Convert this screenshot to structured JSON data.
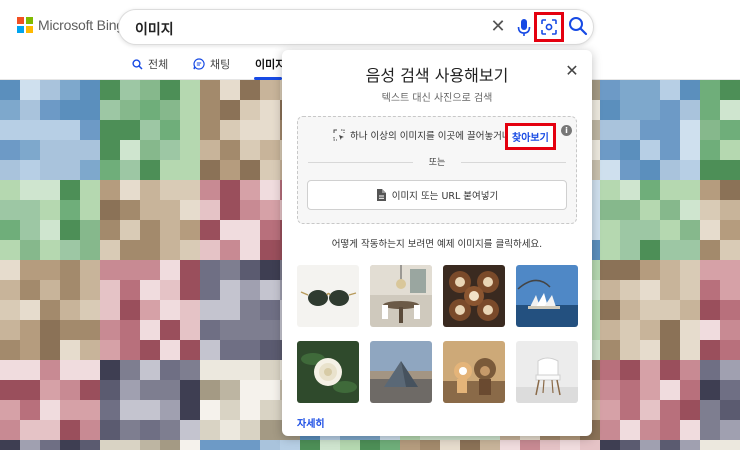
{
  "brand": {
    "name": "Microsoft Bing",
    "colors": [
      "#f25022",
      "#7fba00",
      "#00a4ef",
      "#ffb900"
    ]
  },
  "search": {
    "query": "이미지",
    "clear_icon": "close-icon",
    "mic_icon": "microphone-icon",
    "visual_search_icon": "visual-search-icon",
    "search_icon": "search-icon"
  },
  "tabs": [
    {
      "label": "전체",
      "icon": "search-icon"
    },
    {
      "label": "채팅",
      "icon": "chat-icon"
    },
    {
      "label": "이미지",
      "active": true
    }
  ],
  "panel": {
    "title": "음성 검색 사용해보기",
    "subtitle": "텍스트 대신 사진으로 검색",
    "drop_text": "하나 이상의 이미지를 이곳에 끌어놓거나",
    "browse_label": "찾아보기",
    "or_label": "또는",
    "paste_label": "이미지 또는 URL 붙여넣기",
    "example_hint": "어떻게 작동하는지 보려면 예제 이미지를 클릭하세요.",
    "examples": [
      "sunglasses",
      "dining-room",
      "latte-art",
      "sydney-opera-house",
      "white-rose",
      "louvre-pyramid",
      "dog",
      "white-chair"
    ],
    "learn_more": "자세히"
  },
  "accent": {
    "highlight_red": "#e4000f",
    "link_blue": "#174ae4"
  }
}
